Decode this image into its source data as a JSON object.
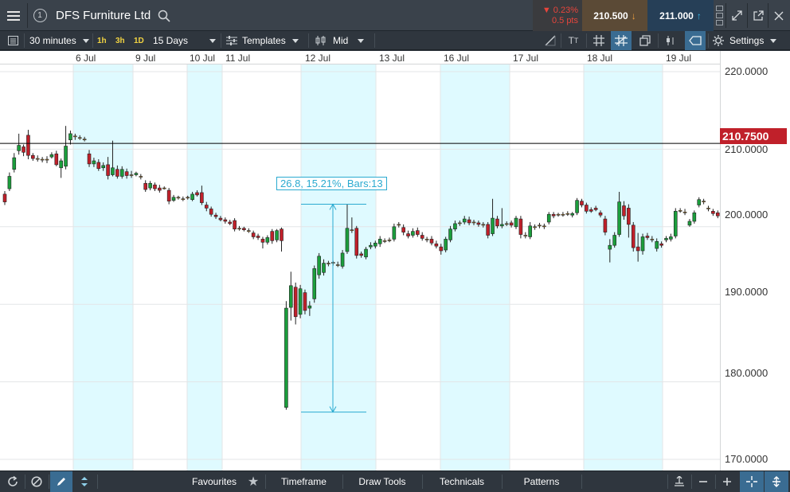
{
  "title_bar": {
    "menu_icon": "hamburger-icon",
    "window_number": "1",
    "instrument_name": "DFS Furniture Ltd",
    "change_percent": "▼ 0.23%",
    "change_points": "0.5 pts",
    "sell_price": "210.500",
    "buy_price": "211.000",
    "sell_arrow": "↓",
    "buy_arrow": "↑"
  },
  "toolbar": {
    "interval": "30 minutes",
    "quick_intervals": [
      "1h",
      "3h",
      "1D"
    ],
    "range": "15 Days",
    "templates_label": "Templates",
    "price_type": "Mid",
    "settings_label": "Settings"
  },
  "bottom_bar": {
    "favourites_label": "Favourites",
    "timeframe_label": "Timeframe",
    "draw_tools_label": "Draw Tools",
    "technicals_label": "Technicals",
    "patterns_label": "Patterns"
  },
  "colors": {
    "up_candle": "#1b9e3c",
    "down_candle": "#c0202a",
    "weekend_band": "#dffaff",
    "price_line": "#000000",
    "price_tag": "#c0202a",
    "measure_tool": "#2aaad0"
  },
  "chart_data": {
    "type": "candlestick",
    "x_labels": [
      "6 Jul",
      "9 Jul",
      "10 Jul",
      "11 Jul",
      "12 Jul",
      "13 Jul",
      "16 Jul",
      "17 Jul",
      "18 Jul",
      "19 Jul"
    ],
    "y_tick_labels": [
      "220.0000",
      "210.0000",
      "200.0000",
      "190.0000",
      "180.0000",
      "170.0000"
    ],
    "y_ticks": [
      220,
      210,
      200,
      190,
      180,
      170
    ],
    "ylim": [
      168.9,
      221.9
    ],
    "current_price": 210.75,
    "current_price_label": "210.7500",
    "measure_label": "26.8, 15.21%, Bars:13",
    "grid": true,
    "candles": [
      {
        "o": 204.2,
        "c": 203.2,
        "h": 204.6,
        "l": 202.8
      },
      {
        "o": 204.9,
        "c": 206.5,
        "h": 207.0,
        "l": 204.6
      },
      {
        "o": 207.4,
        "c": 208.9,
        "h": 209.5,
        "l": 207.0
      },
      {
        "o": 209.8,
        "c": 210.5,
        "h": 212.0,
        "l": 209.3
      },
      {
        "o": 210.3,
        "c": 209.6,
        "h": 210.6,
        "l": 209.1
      },
      {
        "o": 211.8,
        "c": 209.2,
        "h": 212.5,
        "l": 208.7
      },
      {
        "o": 209.2,
        "c": 208.8,
        "h": 209.5,
        "l": 208.5
      },
      {
        "o": 208.8,
        "c": 208.7,
        "h": 209.2,
        "l": 208.4
      },
      {
        "o": 208.7,
        "c": 208.6,
        "h": 209.0,
        "l": 208.3
      },
      {
        "o": 208.6,
        "c": 208.7,
        "h": 209.1,
        "l": 208.2
      },
      {
        "o": 209.0,
        "c": 209.3,
        "h": 209.6,
        "l": 208.8
      },
      {
        "o": 209.4,
        "c": 208.0,
        "h": 209.8,
        "l": 207.8
      },
      {
        "o": 207.6,
        "c": 208.5,
        "h": 208.8,
        "l": 206.3
      },
      {
        "o": 207.8,
        "c": 210.4,
        "h": 213.0,
        "l": 207.4
      },
      {
        "o": 211.2,
        "c": 212.0,
        "h": 212.4,
        "l": 210.6
      },
      {
        "o": 211.7,
        "c": 211.6,
        "h": 212.0,
        "l": 211.2
      },
      {
        "o": 211.5,
        "c": 211.4,
        "h": 211.8,
        "l": 211.2
      },
      {
        "o": 211.3,
        "c": 211.2,
        "h": 211.6,
        "l": 211.0
      },
      {
        "o": 209.4,
        "c": 208.1,
        "h": 209.9,
        "l": 207.7
      },
      {
        "o": 208.1,
        "c": 208.5,
        "h": 208.9,
        "l": 207.7
      },
      {
        "o": 208.3,
        "c": 207.5,
        "h": 208.7,
        "l": 207.2
      },
      {
        "o": 207.6,
        "c": 207.9,
        "h": 208.3,
        "l": 207.2
      },
      {
        "o": 208.0,
        "c": 206.6,
        "h": 209.0,
        "l": 206.1
      },
      {
        "o": 206.7,
        "c": 207.6,
        "h": 211.1,
        "l": 206.5
      },
      {
        "o": 207.4,
        "c": 206.5,
        "h": 207.9,
        "l": 206.2
      },
      {
        "o": 206.5,
        "c": 207.4,
        "h": 207.8,
        "l": 206.2
      },
      {
        "o": 207.1,
        "c": 206.6,
        "h": 207.5,
        "l": 206.2
      },
      {
        "o": 206.7,
        "c": 206.6,
        "h": 207.2,
        "l": 206.3
      },
      {
        "o": 206.7,
        "c": 206.9,
        "h": 207.1,
        "l": 206.5
      },
      {
        "o": 206.5,
        "c": 206.4,
        "h": 206.8,
        "l": 206.1
      },
      {
        "o": 205.6,
        "c": 204.8,
        "h": 206.0,
        "l": 204.5
      },
      {
        "o": 205.0,
        "c": 205.6,
        "h": 205.9,
        "l": 204.7
      },
      {
        "o": 205.4,
        "c": 204.9,
        "h": 205.7,
        "l": 204.6
      },
      {
        "o": 205.0,
        "c": 204.7,
        "h": 205.4,
        "l": 204.4
      },
      {
        "o": 205.0,
        "c": 204.9,
        "h": 205.2,
        "l": 204.8
      },
      {
        "o": 204.7,
        "c": 203.3,
        "h": 205.0,
        "l": 202.9
      },
      {
        "o": 203.4,
        "c": 203.8,
        "h": 204.1,
        "l": 203.2
      },
      {
        "o": 203.8,
        "c": 203.7,
        "h": 204.0,
        "l": 203.5
      },
      {
        "o": 203.6,
        "c": 203.5,
        "h": 203.9,
        "l": 203.3
      },
      {
        "o": 203.7,
        "c": 203.8,
        "h": 204.0,
        "l": 203.5
      },
      {
        "o": 203.5,
        "c": 204.2,
        "h": 204.5,
        "l": 203.3
      },
      {
        "o": 204.4,
        "c": 204.1,
        "h": 204.7,
        "l": 203.9
      },
      {
        "o": 204.4,
        "c": 203.1,
        "h": 205.3,
        "l": 202.8
      },
      {
        "o": 202.8,
        "c": 202.4,
        "h": 203.2,
        "l": 202.0
      },
      {
        "o": 202.3,
        "c": 201.6,
        "h": 202.6,
        "l": 201.3
      },
      {
        "o": 201.5,
        "c": 201.3,
        "h": 201.8,
        "l": 201.0
      },
      {
        "o": 201.1,
        "c": 200.9,
        "h": 201.4,
        "l": 200.7
      },
      {
        "o": 200.9,
        "c": 200.7,
        "h": 201.2,
        "l": 200.4
      },
      {
        "o": 200.6,
        "c": 200.4,
        "h": 200.9,
        "l": 200.2
      },
      {
        "o": 200.8,
        "c": 199.7,
        "h": 201.1,
        "l": 199.4
      },
      {
        "o": 199.8,
        "c": 199.7,
        "h": 200.1,
        "l": 199.5
      },
      {
        "o": 199.8,
        "c": 199.6,
        "h": 200.0,
        "l": 199.4
      },
      {
        "o": 199.5,
        "c": 199.4,
        "h": 199.8,
        "l": 199.2
      },
      {
        "o": 199.2,
        "c": 198.7,
        "h": 199.5,
        "l": 198.4
      },
      {
        "o": 198.8,
        "c": 198.6,
        "h": 199.1,
        "l": 198.3
      },
      {
        "o": 198.4,
        "c": 198.0,
        "h": 198.7,
        "l": 197.2
      },
      {
        "o": 198.0,
        "c": 198.6,
        "h": 198.9,
        "l": 197.7
      },
      {
        "o": 199.4,
        "c": 198.2,
        "h": 199.7,
        "l": 197.8
      },
      {
        "o": 198.3,
        "c": 199.5,
        "h": 199.7,
        "l": 198.0
      },
      {
        "o": 199.7,
        "c": 198.2,
        "h": 199.9,
        "l": 196.8
      },
      {
        "o": 176.7,
        "c": 189.5,
        "h": 190.4,
        "l": 176.4
      },
      {
        "o": 189.6,
        "c": 192.4,
        "h": 194.2,
        "l": 187.9
      },
      {
        "o": 192.2,
        "c": 188.4,
        "h": 192.8,
        "l": 187.4
      },
      {
        "o": 188.7,
        "c": 192.0,
        "h": 192.5,
        "l": 188.2
      },
      {
        "o": 191.5,
        "c": 189.2,
        "h": 191.9,
        "l": 188.7
      },
      {
        "o": 189.5,
        "c": 189.8,
        "h": 190.4,
        "l": 188.5
      },
      {
        "o": 190.7,
        "c": 194.6,
        "h": 195.0,
        "l": 190.2
      },
      {
        "o": 193.8,
        "c": 196.2,
        "h": 196.6,
        "l": 193.3
      },
      {
        "o": 194.1,
        "c": 195.3,
        "h": 195.8,
        "l": 193.7
      },
      {
        "o": 195.2,
        "c": 195.3,
        "h": 195.6,
        "l": 194.9
      },
      {
        "o": 195.4,
        "c": 195.3,
        "h": 195.6,
        "l": 195.0
      },
      {
        "o": 195.0,
        "c": 195.1,
        "h": 195.5,
        "l": 194.8
      },
      {
        "o": 194.9,
        "c": 196.6,
        "h": 197.0,
        "l": 194.6
      },
      {
        "o": 196.8,
        "c": 199.8,
        "h": 202.9,
        "l": 196.5
      },
      {
        "o": 199.5,
        "c": 199.6,
        "h": 201.2,
        "l": 199.2
      },
      {
        "o": 199.8,
        "c": 196.3,
        "h": 200.1,
        "l": 195.9
      },
      {
        "o": 196.5,
        "c": 196.3,
        "h": 196.8,
        "l": 196.0
      },
      {
        "o": 196.1,
        "c": 197.1,
        "h": 197.4,
        "l": 195.8
      },
      {
        "o": 197.4,
        "c": 197.6,
        "h": 198.0,
        "l": 197.1
      },
      {
        "o": 197.5,
        "c": 197.9,
        "h": 198.2,
        "l": 197.2
      },
      {
        "o": 197.8,
        "c": 198.4,
        "h": 198.8,
        "l": 197.4
      },
      {
        "o": 198.1,
        "c": 198.2,
        "h": 198.5,
        "l": 197.9
      },
      {
        "o": 198.2,
        "c": 198.3,
        "h": 198.6,
        "l": 198.0
      },
      {
        "o": 198.4,
        "c": 200.0,
        "h": 200.4,
        "l": 198.1
      },
      {
        "o": 200.2,
        "c": 200.3,
        "h": 200.6,
        "l": 199.9
      },
      {
        "o": 199.9,
        "c": 199.3,
        "h": 200.3,
        "l": 198.9
      },
      {
        "o": 199.1,
        "c": 198.8,
        "h": 199.5,
        "l": 198.5
      },
      {
        "o": 198.9,
        "c": 199.4,
        "h": 199.8,
        "l": 198.6
      },
      {
        "o": 199.5,
        "c": 199.0,
        "h": 199.9,
        "l": 198.7
      },
      {
        "o": 198.9,
        "c": 198.5,
        "h": 199.3,
        "l": 198.2
      },
      {
        "o": 198.3,
        "c": 198.4,
        "h": 198.7,
        "l": 198.0
      },
      {
        "o": 198.4,
        "c": 197.9,
        "h": 198.8,
        "l": 197.6
      },
      {
        "o": 197.8,
        "c": 197.5,
        "h": 198.2,
        "l": 197.2
      },
      {
        "o": 197.4,
        "c": 196.9,
        "h": 197.8,
        "l": 196.4
      },
      {
        "o": 197.0,
        "c": 198.4,
        "h": 198.7,
        "l": 196.7
      },
      {
        "o": 198.3,
        "c": 199.7,
        "h": 200.1,
        "l": 198.0
      },
      {
        "o": 199.7,
        "c": 200.4,
        "h": 200.8,
        "l": 199.4
      },
      {
        "o": 200.4,
        "c": 200.5,
        "h": 200.8,
        "l": 200.1
      },
      {
        "o": 200.6,
        "c": 201.0,
        "h": 201.4,
        "l": 200.3
      },
      {
        "o": 200.9,
        "c": 200.5,
        "h": 201.3,
        "l": 200.2
      },
      {
        "o": 200.6,
        "c": 200.5,
        "h": 200.9,
        "l": 200.2
      },
      {
        "o": 200.5,
        "c": 200.3,
        "h": 200.8,
        "l": 200.0
      },
      {
        "o": 200.3,
        "c": 200.2,
        "h": 200.6,
        "l": 199.9
      },
      {
        "o": 200.3,
        "c": 198.9,
        "h": 200.6,
        "l": 198.5
      },
      {
        "o": 199.1,
        "c": 201.1,
        "h": 203.6,
        "l": 198.8
      },
      {
        "o": 201.0,
        "c": 200.1,
        "h": 201.4,
        "l": 199.8
      },
      {
        "o": 200.1,
        "c": 200.3,
        "h": 202.4,
        "l": 199.8
      },
      {
        "o": 200.3,
        "c": 200.4,
        "h": 200.7,
        "l": 200.1
      },
      {
        "o": 200.5,
        "c": 200.2,
        "h": 200.8,
        "l": 199.9
      },
      {
        "o": 200.0,
        "c": 201.1,
        "h": 201.4,
        "l": 199.7
      },
      {
        "o": 201.0,
        "c": 199.0,
        "h": 201.4,
        "l": 198.5
      },
      {
        "o": 198.9,
        "c": 198.8,
        "h": 199.3,
        "l": 198.5
      },
      {
        "o": 198.7,
        "c": 200.1,
        "h": 200.6,
        "l": 198.4
      },
      {
        "o": 200.0,
        "c": 199.9,
        "h": 200.3,
        "l": 199.6
      },
      {
        "o": 200.1,
        "c": 200.2,
        "h": 200.5,
        "l": 199.8
      },
      {
        "o": 200.0,
        "c": 200.1,
        "h": 200.4,
        "l": 199.7
      },
      {
        "o": 200.6,
        "c": 201.6,
        "h": 201.9,
        "l": 200.3
      },
      {
        "o": 201.6,
        "c": 201.4,
        "h": 201.9,
        "l": 201.1
      },
      {
        "o": 201.5,
        "c": 201.6,
        "h": 201.8,
        "l": 201.3
      },
      {
        "o": 201.6,
        "c": 201.6,
        "h": 201.9,
        "l": 201.3
      },
      {
        "o": 201.7,
        "c": 201.6,
        "h": 202.0,
        "l": 201.4
      },
      {
        "o": 201.5,
        "c": 201.7,
        "h": 201.9,
        "l": 201.2
      },
      {
        "o": 201.8,
        "c": 203.4,
        "h": 203.7,
        "l": 201.5
      },
      {
        "o": 203.3,
        "c": 202.8,
        "h": 203.6,
        "l": 202.5
      },
      {
        "o": 202.8,
        "c": 202.0,
        "h": 203.1,
        "l": 201.7
      },
      {
        "o": 202.2,
        "c": 202.0,
        "h": 202.5,
        "l": 201.8
      },
      {
        "o": 202.4,
        "c": 202.2,
        "h": 202.7,
        "l": 202.0
      },
      {
        "o": 201.8,
        "c": 201.5,
        "h": 202.1,
        "l": 201.2
      },
      {
        "o": 201.0,
        "c": 199.3,
        "h": 201.4,
        "l": 198.9
      },
      {
        "o": 197.1,
        "c": 197.6,
        "h": 198.4,
        "l": 195.4
      },
      {
        "o": 197.6,
        "c": 198.9,
        "h": 199.3,
        "l": 197.3
      },
      {
        "o": 199.0,
        "c": 203.2,
        "h": 204.5,
        "l": 198.7
      },
      {
        "o": 202.7,
        "c": 201.4,
        "h": 203.3,
        "l": 200.9
      },
      {
        "o": 202.4,
        "c": 200.3,
        "h": 202.9,
        "l": 198.6
      },
      {
        "o": 200.2,
        "c": 197.3,
        "h": 200.6,
        "l": 196.8
      },
      {
        "o": 197.4,
        "c": 196.9,
        "h": 199.2,
        "l": 195.5
      },
      {
        "o": 196.9,
        "c": 198.7,
        "h": 199.1,
        "l": 196.4
      },
      {
        "o": 198.8,
        "c": 198.6,
        "h": 199.2,
        "l": 198.3
      },
      {
        "o": 198.4,
        "c": 198.3,
        "h": 198.8,
        "l": 198.0
      },
      {
        "o": 197.2,
        "c": 198.1,
        "h": 198.5,
        "l": 196.8
      },
      {
        "o": 197.8,
        "c": 197.6,
        "h": 198.1,
        "l": 197.3
      },
      {
        "o": 198.3,
        "c": 198.5,
        "h": 198.8,
        "l": 198.0
      },
      {
        "o": 198.4,
        "c": 198.7,
        "h": 199.1,
        "l": 198.1
      },
      {
        "o": 198.8,
        "c": 202.0,
        "h": 202.4,
        "l": 198.5
      },
      {
        "o": 202.0,
        "c": 202.1,
        "h": 202.4,
        "l": 201.8
      },
      {
        "o": 201.9,
        "c": 201.8,
        "h": 202.3,
        "l": 201.5
      },
      {
        "o": 200.2,
        "c": 200.7,
        "h": 201.0,
        "l": 200.0
      },
      {
        "o": 200.7,
        "c": 201.8,
        "h": 202.1,
        "l": 200.4
      },
      {
        "o": 202.8,
        "c": 203.5,
        "h": 203.8,
        "l": 202.5
      },
      {
        "o": 203.3,
        "c": 203.2,
        "h": 203.6,
        "l": 202.9
      },
      {
        "o": 202.4,
        "c": 202.3,
        "h": 202.7,
        "l": 202.0
      },
      {
        "o": 202.0,
        "c": 201.7,
        "h": 202.3,
        "l": 201.4
      },
      {
        "o": 201.8,
        "c": 201.4,
        "h": 202.1,
        "l": 201.1
      },
      {
        "o": 201.1,
        "c": 200.8,
        "h": 201.4,
        "l": 200.5
      },
      {
        "o": 200.7,
        "c": 200.5,
        "h": 201.0,
        "l": 200.2
      }
    ]
  }
}
